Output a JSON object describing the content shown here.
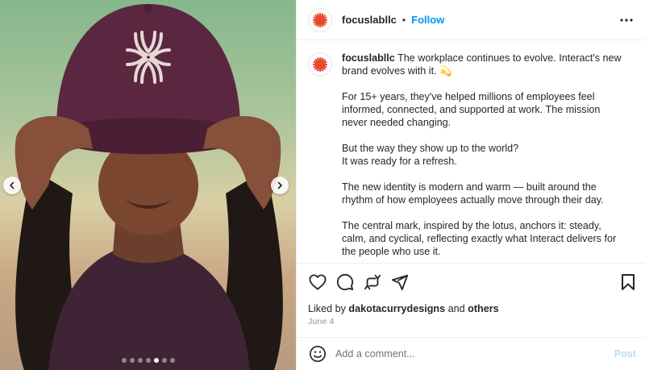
{
  "post": {
    "username": "focuslabllc",
    "follow_label": "Follow",
    "separator": "•",
    "caption_paragraphs": [
      "The workplace continues to evolve. Interact's new brand evolves with it. 💫",
      "For 15+ years, they've helped millions of employees feel informed, connected, and supported at work. The mission never needed changing.",
      "But the way they show up to the world?\nIt was ready for a refresh.",
      "The new identity is modern and warm — built around the rhythm of how employees actually move through their day.",
      "The central mark, inspired by the lotus, anchors it: steady, calm, and cyclical, reflecting exactly what Interact delivers for the people who use it."
    ],
    "liked_by_prefix": "Liked by",
    "liked_by_user": "dakotacurrydesigns",
    "liked_by_and": "and",
    "liked_by_others": "others",
    "date": "June 4",
    "comment_placeholder": "Add a comment...",
    "post_button": "Post"
  },
  "carousel": {
    "total_slides": 7,
    "active_index": 4
  },
  "colors": {
    "brand_red": "#e8472b",
    "follow_blue": "#0095f6",
    "post_disabled": "#b2dffc",
    "cap_plum": "#4e1f33"
  },
  "icons": {
    "avatar": "sunburst-logo-icon",
    "more": "more-horizontal-icon",
    "like": "heart-icon",
    "comment": "comment-bubble-icon",
    "share": "repost-icon",
    "send": "send-paper-plane-icon",
    "save": "bookmark-icon",
    "emoji": "smiley-icon",
    "prev": "chevron-left-icon",
    "next": "chevron-right-icon"
  }
}
